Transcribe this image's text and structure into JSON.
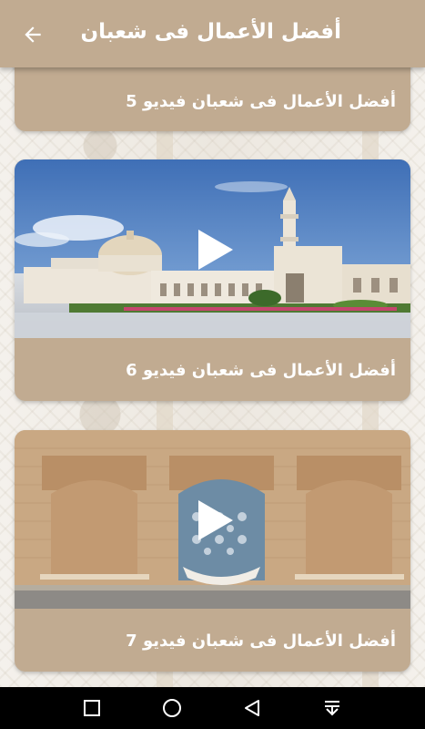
{
  "appbar": {
    "title": "أفضل الأعمال فى شعبان",
    "back_icon": "arrow-back-icon"
  },
  "videos": [
    {
      "label": "أفضل الأعمال فى شعبان فيديو 5",
      "thumbnail": "none-visible"
    },
    {
      "label": "أفضل الأعمال فى شعبان فيديو 6",
      "thumbnail": "mosque-photo"
    },
    {
      "label": "أفضل الأعمال فى شعبان فيديو 7",
      "thumbnail": "moroccan-fountain-photo"
    }
  ],
  "navbar": {
    "icons": [
      "recents-square-icon",
      "home-circle-icon",
      "back-triangle-icon",
      "notification-pull-icon"
    ]
  },
  "colors": {
    "accent": "#c1ab91",
    "card_text": "#ffffff",
    "navbar": "#000000"
  }
}
